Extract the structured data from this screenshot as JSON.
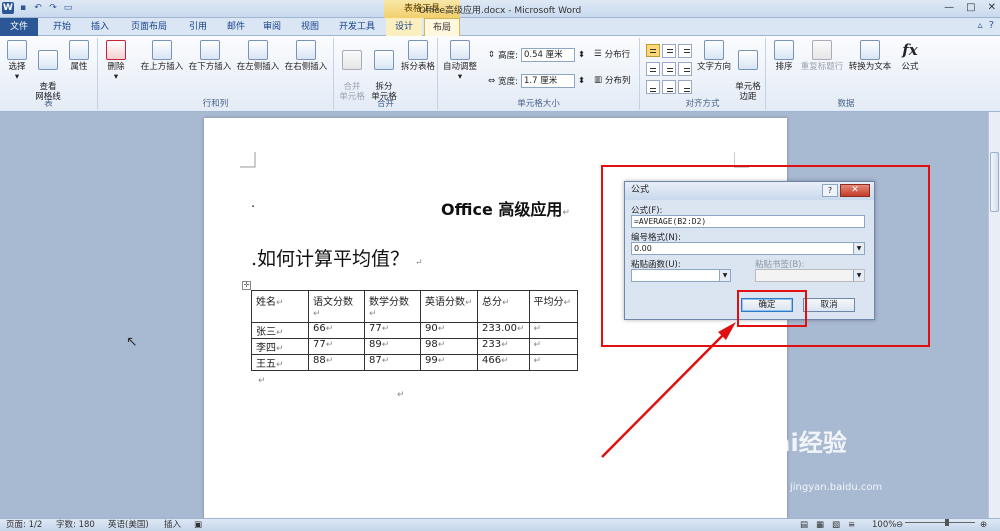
{
  "titlebar": {
    "doc_title": "Office高级应用.docx - Microsoft Word",
    "context_tools": "表格工具",
    "qat_icons": [
      "word-logo",
      "save-icon",
      "undo-icon",
      "redo-icon",
      "open-icon"
    ],
    "win_min": "—",
    "win_max": "□",
    "win_close": "✕"
  },
  "tabs": {
    "file": "文件",
    "items": [
      "开始",
      "插入",
      "页面布局",
      "引用",
      "邮件",
      "审阅",
      "视图",
      "开发工具"
    ],
    "design": "设计",
    "layout": "布局"
  },
  "ribbon": {
    "table_group": {
      "label": "表",
      "select": "选择",
      "gridlines": "查看\n网格线",
      "props": "属性"
    },
    "rowcol_group": {
      "label": "行和列",
      "delete": "删除",
      "above": "在上方插入",
      "below": "在下方插入",
      "left": "在左侧插入",
      "right": "在右侧插入"
    },
    "merge_group": {
      "label": "合并",
      "merge": "合并\n单元格",
      "split": "拆分\n单元格",
      "split_table": "拆分表格"
    },
    "cellsize_group": {
      "label": "单元格大小",
      "autofit": "自动调整",
      "height_label": "高度:",
      "height_value": "0.54 厘米",
      "width_label": "宽度:",
      "width_value": "1.7 厘米",
      "dist_rows": "分布行",
      "dist_cols": "分布列"
    },
    "align_group": {
      "label": "对齐方式",
      "text_dir": "文字方向",
      "margins": "单元格\n边距"
    },
    "data_group": {
      "label": "数据",
      "sort": "排序",
      "repeat": "重复标题行",
      "convert": "转换为文本",
      "formula": "公式"
    }
  },
  "document": {
    "bullet": "·",
    "title": "Office 高级应用",
    "heading": ".如何计算平均值？",
    "para_mark": "↵",
    "table_headers": [
      "姓名",
      "语文分数",
      "数学分数",
      "英语分数",
      "总分",
      "平均分"
    ],
    "table_rows": [
      [
        "张三",
        "66",
        "77",
        "90",
        "233.00",
        ""
      ],
      [
        "李四",
        "77",
        "89",
        "98",
        "233",
        ""
      ],
      [
        "王五",
        "88",
        "87",
        "99",
        "466",
        ""
      ]
    ]
  },
  "dialog": {
    "title": "公式",
    "help": "?",
    "close": "✕",
    "formula_label": "公式(F):",
    "formula_value": "=AVERAGE(B2:D2)",
    "format_label": "编号格式(N):",
    "format_value": "0.00",
    "paste_func_label": "粘贴函数(U):",
    "paste_bookmark_label": "粘贴书签(B):",
    "ok": "确定",
    "cancel": "取消"
  },
  "statusbar": {
    "page": "页面: 1/2",
    "words": "字数: 180",
    "lang": "英语(美国)",
    "mode": "插入",
    "zoom": "100%"
  },
  "watermark": {
    "brand": "Bai经验",
    "url": "jingyan.baidu.com"
  },
  "colors": {
    "accent": "#2b5797",
    "highlight": "#e01010",
    "context": "#f2cf6c"
  }
}
